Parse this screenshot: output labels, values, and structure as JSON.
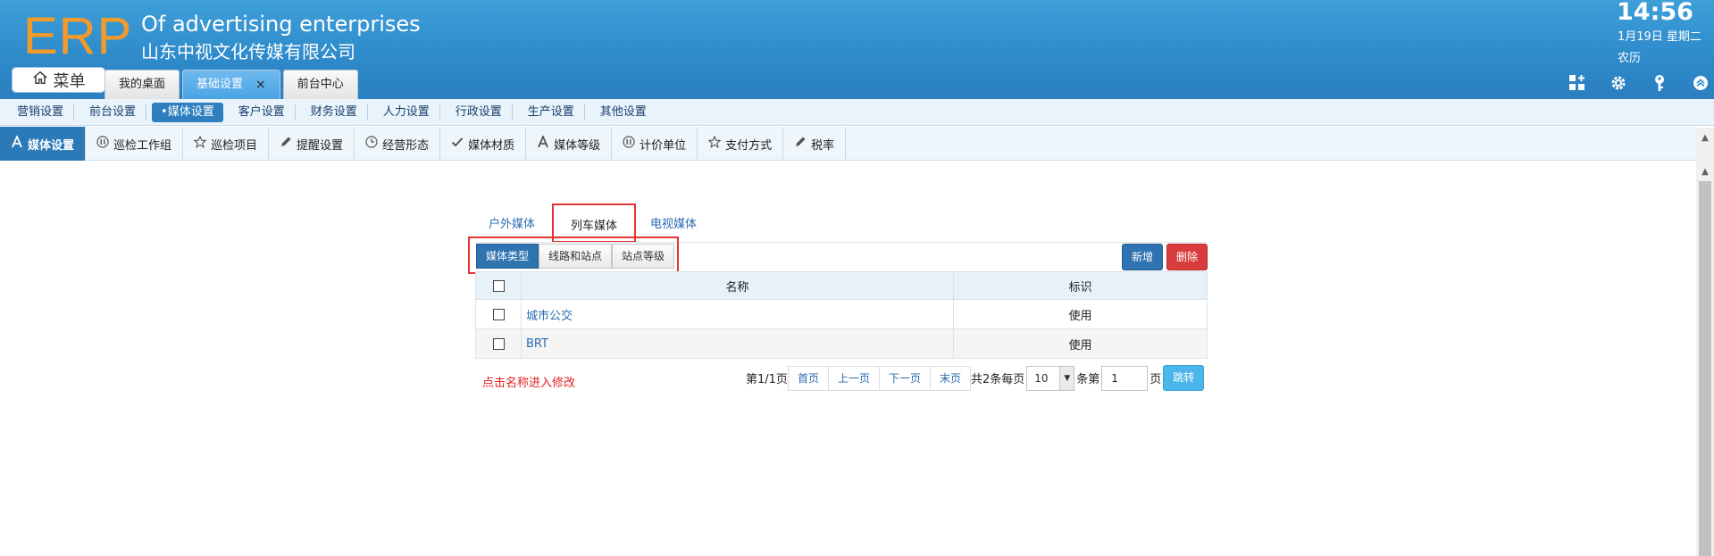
{
  "header": {
    "logo": "ERP",
    "brand_en": "Of advertising enterprises",
    "brand_cn": "山东中视文化传媒有限公司",
    "time": "14:56",
    "date": "1月19日 星期二",
    "lunar": "农历",
    "menu_label": "菜单",
    "tabs": [
      {
        "label": "我的桌面"
      },
      {
        "label": "基础设置",
        "close": "×"
      },
      {
        "label": "前台中心"
      }
    ],
    "icons": [
      "grid-add-icon",
      "gear-icon",
      "key-icon",
      "collapse-up-icon"
    ]
  },
  "settings_nav": [
    "营销设置",
    "前台设置",
    "•媒体设置",
    "客户设置",
    "财务设置",
    "人力设置",
    "行政设置",
    "生产设置",
    "其他设置"
  ],
  "sub_nav": [
    {
      "label": "媒体设置",
      "icon": "letter-a-icon"
    },
    {
      "label": "巡检工作组",
      "icon": "pause-circle-icon"
    },
    {
      "label": "巡检项目",
      "icon": "star-icon"
    },
    {
      "label": "提醒设置",
      "icon": "pencil-icon"
    },
    {
      "label": "经营形态",
      "icon": "clock-icon"
    },
    {
      "label": "媒体材质",
      "icon": "check-icon"
    },
    {
      "label": "媒体等级",
      "icon": "letter-a-icon"
    },
    {
      "label": "计价单位",
      "icon": "pause-circle-icon"
    },
    {
      "label": "支付方式",
      "icon": "star-icon"
    },
    {
      "label": "税率",
      "icon": "pencil-icon"
    }
  ],
  "media_tabs": [
    "户外媒体",
    "列车媒体",
    "电视媒体"
  ],
  "toolbar": {
    "group": [
      "媒体类型",
      "线路和站点",
      "站点等级"
    ],
    "new_label": "新增",
    "delete_label": "删除"
  },
  "table": {
    "headers": [
      "名称",
      "标识"
    ],
    "rows": [
      {
        "name": "城市公交",
        "flag": "使用"
      },
      {
        "name": "BRT",
        "flag": "使用"
      }
    ]
  },
  "hint": "点击名称进入修改",
  "pager": {
    "page_info": "第1/1页",
    "first": "首页",
    "prev": "上一页",
    "next": "下一页",
    "last": "末页",
    "total_prefix": "共2条每页",
    "page_size": "10",
    "unit_goto": "条第",
    "goto_value": "1",
    "page_suffix": "页",
    "go_label": "跳转"
  },
  "colors": {
    "header_blue": "#2f8bcb",
    "logo_orange": "#f39a2a",
    "accent_blue": "#2f73b0",
    "danger_red": "#d93c3c",
    "highlight_red": "#e53232"
  }
}
